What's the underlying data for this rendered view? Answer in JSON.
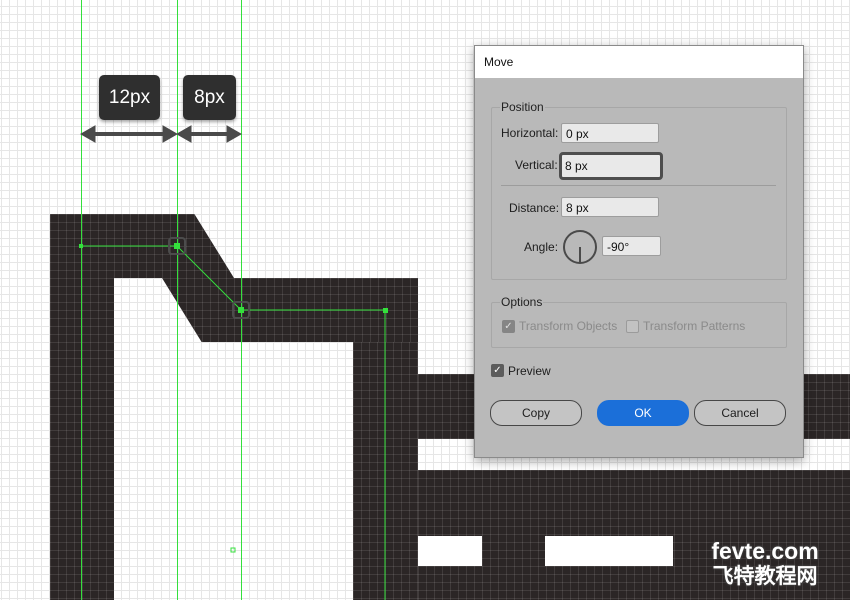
{
  "annotations": {
    "measure_1": "12px",
    "measure_2": "8px"
  },
  "dialog": {
    "title": "Move",
    "position": {
      "title": "Position",
      "horizontal_label": "Horizontal:",
      "horizontal_value": "0 px",
      "vertical_label": "Vertical:",
      "vertical_value": "8 px",
      "distance_label": "Distance:",
      "distance_value": "8 px",
      "angle_label": "Angle:",
      "angle_value": "-90°"
    },
    "options": {
      "title": "Options",
      "transform_objects": "Transform Objects",
      "transform_objects_checked": true,
      "transform_patterns": "Transform Patterns",
      "transform_patterns_checked": false
    },
    "preview_label": "Preview",
    "preview_checked": true,
    "buttons": {
      "copy": "Copy",
      "ok": "OK",
      "cancel": "Cancel"
    }
  },
  "watermark": {
    "line1": "fevte.com",
    "line2": "飞特教程网"
  },
  "colors": {
    "guide": "#34e03c",
    "shape": "#2b2626",
    "accent": "#1b6fd9"
  }
}
